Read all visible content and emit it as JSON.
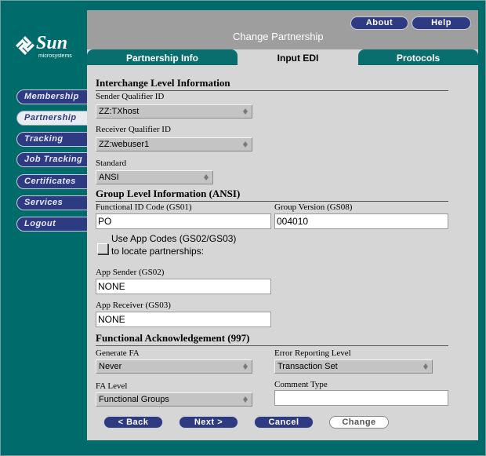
{
  "brand": {
    "name": "Sun",
    "tagline": "microsystems"
  },
  "sidebar": {
    "items": [
      {
        "label": "Membership"
      },
      {
        "label": "Partnership"
      },
      {
        "label": "Tracking"
      },
      {
        "label": "Job Tracking"
      },
      {
        "label": "Certificates"
      },
      {
        "label": "Services"
      },
      {
        "label": "Logout"
      }
    ],
    "active": "Partnership"
  },
  "header": {
    "title": "Change Partnership",
    "about_label": "About",
    "help_label": "Help"
  },
  "tabs": [
    {
      "label": "Partnership Info"
    },
    {
      "label": "Input EDI"
    },
    {
      "label": "Protocols"
    }
  ],
  "active_tab": "Input EDI",
  "interchange": {
    "heading": "Interchange Level Information",
    "sender_label": "Sender Qualifier ID",
    "sender_value": "ZZ:TXhost",
    "receiver_label": "Receiver Qualifier ID",
    "receiver_value": "ZZ:webuser1",
    "standard_label": "Standard",
    "standard_value": "ANSI"
  },
  "group": {
    "heading": "Group Level Information (ANSI)",
    "func_id_label": "Functional ID Code (GS01)",
    "func_id_value": "PO",
    "version_label": "Group Version (GS08)",
    "version_value": "004010",
    "use_app_codes_line1": "Use App Codes (GS02/GS03)",
    "use_app_codes_line2": "to locate partnerships:",
    "use_app_codes_checked": false,
    "app_sender_label": "App Sender (GS02)",
    "app_sender_value": "NONE",
    "app_receiver_label": "App Receiver (GS03)",
    "app_receiver_value": "NONE"
  },
  "ack": {
    "heading": "Functional Acknowledgement (997)",
    "generate_label": "Generate FA",
    "generate_value": "Never",
    "error_label": "Error Reporting Level",
    "error_value": "Transaction Set",
    "level_label": "FA Level",
    "level_value": "Functional Groups",
    "comment_label": "Comment Type",
    "comment_value": ""
  },
  "footer": {
    "back_label": "< Back",
    "next_label": "Next >",
    "cancel_label": "Cancel",
    "change_label": "Change"
  },
  "colors": {
    "frame": "#006b6b",
    "panel": "#d6d6d6",
    "header_band": "#9e9e9e",
    "button": "#2e3a82",
    "tab": "#0a6e6e"
  }
}
